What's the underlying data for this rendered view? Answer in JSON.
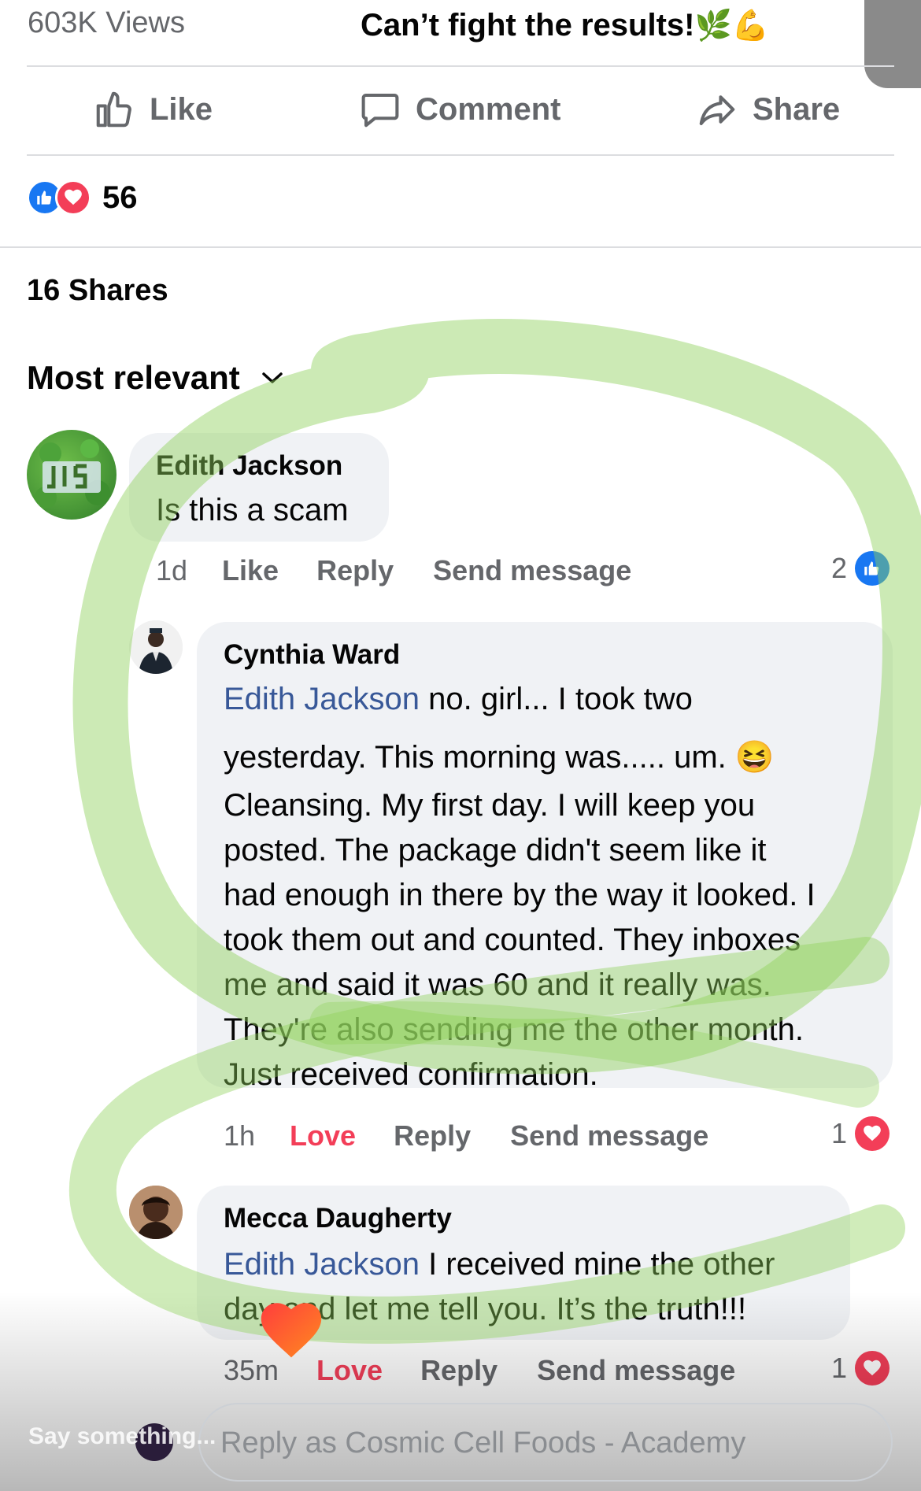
{
  "post": {
    "views": "603K Views",
    "caption": "Can’t fight the results!",
    "caption_emoji": "🌿💪"
  },
  "actions": {
    "like": "Like",
    "comment": "Comment",
    "share": "Share"
  },
  "reactions": {
    "icons": [
      "like-icon",
      "love-icon"
    ],
    "count": "56"
  },
  "shares": "16 Shares",
  "sort": {
    "label": "Most relevant"
  },
  "comments": [
    {
      "author": "Edith Jackson",
      "text": "Is this a scam",
      "time": "1d",
      "action_react": "Like",
      "action_reply": "Reply",
      "action_message": "Send message",
      "react_count": "2",
      "react_icon": "like-icon"
    },
    {
      "author": "Cynthia Ward",
      "mention": "Edith Jackson",
      "text_first": "no. girl... I took two",
      "text_rest_1": "yesterday. This morning was..... um. 😆",
      "text_rest_2": "Cleansing. My first day. I will keep you",
      "text_rest_3": "posted. The package didn't seem like it",
      "text_rest_4": "had enough in there by the way it looked. I",
      "text_rest_5": "took them out and counted.  They inboxes",
      "text_rest_6": "me and said it was 60 and it really was.",
      "text_rest_7": "They're also sending me the other month.",
      "text_rest_8": "Just received confirmation.",
      "time": "1h",
      "action_react": "Love",
      "action_reply": "Reply",
      "action_message": "Send message",
      "react_count": "1",
      "react_icon": "love-icon"
    },
    {
      "author": "Mecca Daugherty",
      "mention": "Edith Jackson",
      "text_first": "I received mine the other",
      "text_rest_1": "day and let me tell you.  It’s the truth!!!",
      "time": "35m",
      "action_react": "Love",
      "action_reply": "Reply",
      "action_message": "Send message",
      "react_count": "1",
      "react_icon": "love-icon"
    }
  ],
  "reply_box": {
    "placeholder": "Reply as Cosmic Cell Foods - Academy"
  },
  "overlay": {
    "say_something": "Say something..."
  },
  "colors": {
    "like_blue": "#1877f2",
    "love_red": "#f33e58",
    "mention_blue": "#385898",
    "highlighter_green": "#8fd15a"
  }
}
